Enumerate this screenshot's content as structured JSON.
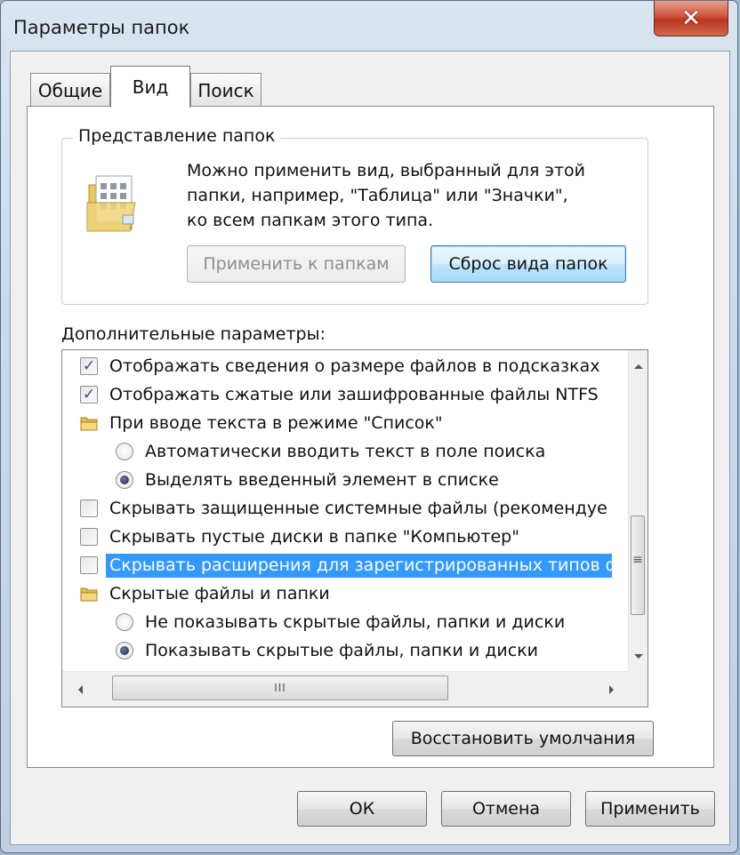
{
  "window": {
    "title": "Параметры папок",
    "close_glyph": "✕"
  },
  "tabs": [
    {
      "label": "Общие",
      "active": false
    },
    {
      "label": "Вид",
      "active": true
    },
    {
      "label": "Поиск",
      "active": false
    }
  ],
  "folder_views": {
    "title": "Представление папок",
    "desc_line1": "Можно применить вид, выбранный для этой",
    "desc_line2": "папки, например, \"Таблица\" или \"Значки\",",
    "desc_line3": "ко всем папкам этого типа.",
    "apply_button": "Применить к папкам",
    "reset_button": "Сброс вида папок"
  },
  "advanced": {
    "label": "Дополнительные параметры:",
    "items": [
      {
        "type": "checkbox",
        "checked": true,
        "label": "Отображать сведения о размере файлов в подсказках"
      },
      {
        "type": "checkbox",
        "checked": true,
        "label": "Отображать сжатые или зашифрованные файлы NTFS"
      },
      {
        "type": "folder",
        "label": "При вводе текста в режиме \"Список\""
      },
      {
        "type": "radio",
        "checked": false,
        "label": "Автоматически вводить текст в поле поиска"
      },
      {
        "type": "radio",
        "checked": true,
        "label": "Выделять введенный элемент в списке"
      },
      {
        "type": "checkbox",
        "checked": false,
        "label": "Скрывать защищенные системные файлы (рекомендуе"
      },
      {
        "type": "checkbox",
        "checked": false,
        "label": "Скрывать пустые диски в папке \"Компьютер\""
      },
      {
        "type": "checkbox",
        "checked": false,
        "label": "Скрывать расширения для зарегистрированных типов ф",
        "selected": true
      },
      {
        "type": "folder",
        "label": "Скрытые файлы и папки"
      },
      {
        "type": "radio",
        "checked": false,
        "label": "Не показывать скрытые файлы, папки и диски"
      },
      {
        "type": "radio",
        "checked": true,
        "label": "Показывать скрытые файлы, папки и диски"
      }
    ],
    "check_glyph": "✓",
    "hscroll_grip": "III",
    "vscroll_grip": "≡"
  },
  "restore_button": "Восстановить умолчания",
  "footer": {
    "ok": "ОК",
    "cancel": "Отмена",
    "apply": "Применить"
  }
}
